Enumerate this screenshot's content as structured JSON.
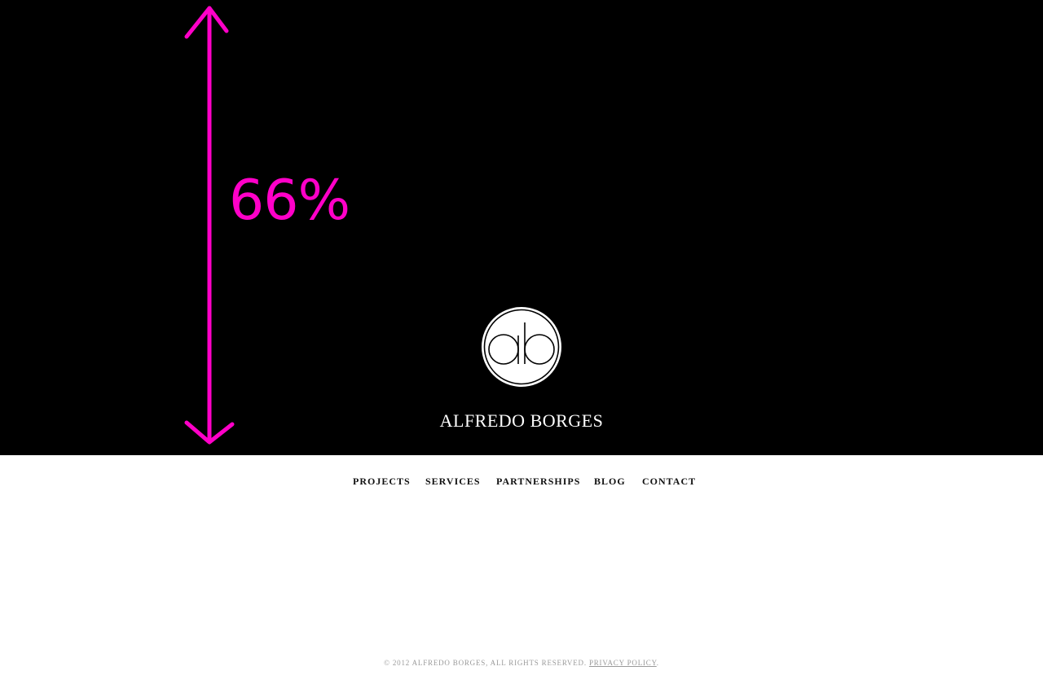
{
  "annotation": {
    "label": "66%",
    "color": "#ff00c8"
  },
  "brand": {
    "logo_icon": "ab-monogram-icon",
    "name": "ALFREDO BORGES"
  },
  "nav": {
    "items": [
      {
        "label": "PROJECTS"
      },
      {
        "label": "SERVICES"
      },
      {
        "label": "PARTNERSHIPS"
      },
      {
        "label": "BLOG"
      },
      {
        "label": "CONTACT"
      }
    ]
  },
  "footer": {
    "copyright": "© 2012 ALFREDO BORGES, ALL RIGHTS RESERVED.",
    "privacy_link": "PRIVACY POLICY",
    "end_punct": "."
  },
  "colors": {
    "hero_background": "#000000",
    "page_background": "#ffffff",
    "annotation": "#ff00c8",
    "footer_text": "#9a9a9a"
  }
}
